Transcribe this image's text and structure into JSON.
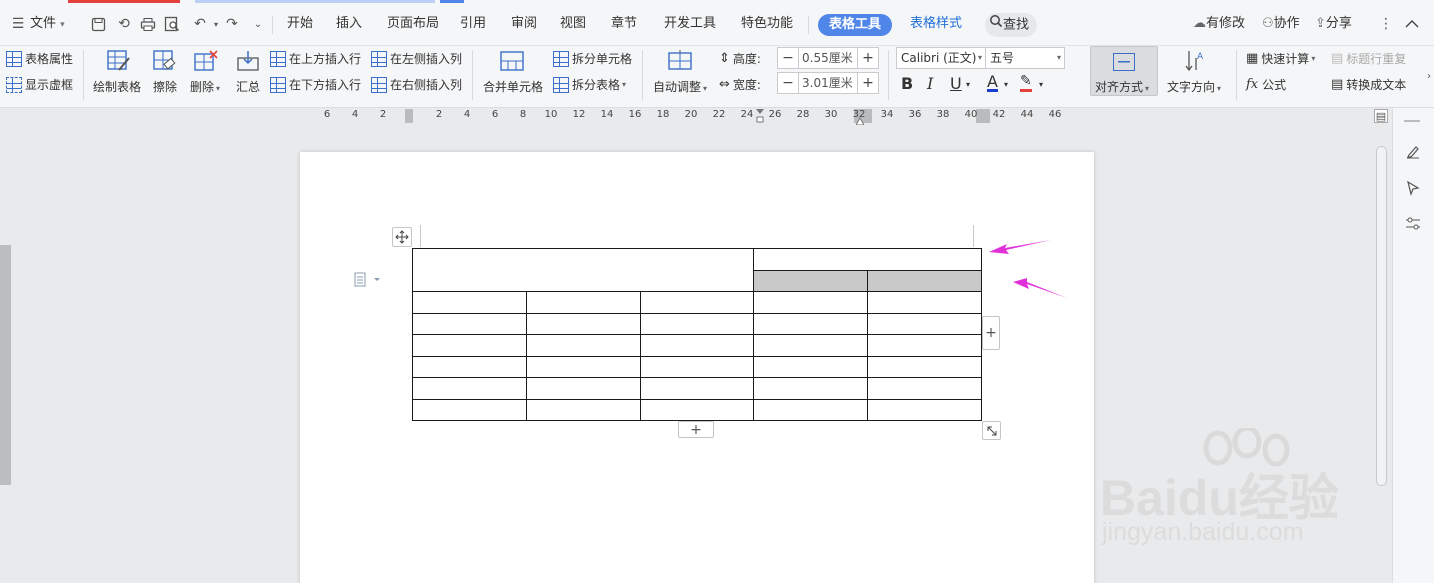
{
  "colors": {
    "accent": "#4f86e8",
    "table_tab_blue": "#1e6fd9",
    "arrow_magenta": "#e030d8",
    "shaded_cell": "#c9c9c9",
    "tabstrip_red": "#e5413a",
    "tabstrip_blue": "#4f86e8"
  },
  "menubar": {
    "file": "文件",
    "tabs": [
      "开始",
      "插入",
      "页面布局",
      "引用",
      "审阅",
      "视图",
      "章节",
      "开发工具",
      "特色功能"
    ],
    "active_tab": "表格工具",
    "secondary_tab": "表格样式",
    "search": "查找",
    "modified": "有修改",
    "collaborate": "协作",
    "share": "分享"
  },
  "ribbon": {
    "table_props": "表格属性",
    "show_gridlines": "显示虚框",
    "draw_table": "绘制表格",
    "erase": "擦除",
    "delete": "删除",
    "summarize": "汇总",
    "insert_row_above": "在上方插入行",
    "insert_row_below": "在下方插入行",
    "insert_col_left": "在左侧插入列",
    "insert_col_right": "在右侧插入列",
    "merge_cells": "合并单元格",
    "split_cells": "拆分单元格",
    "split_table": "拆分表格",
    "auto_fit": "自动调整",
    "height_label": "高度:",
    "height_value": "0.55厘米",
    "width_label": "宽度:",
    "width_value": "3.01厘米",
    "font_name": "Calibri (正文)",
    "font_size": "五号",
    "align": "对齐方式",
    "text_direction": "文字方向",
    "quick_calc": "快速计算",
    "repeat_header": "标题行重复",
    "formula": "公式",
    "convert_text": "转换成文本"
  },
  "ruler": {
    "labels": [
      "6",
      "4",
      "2",
      "2",
      "4",
      "6",
      "8",
      "10",
      "12",
      "14",
      "16",
      "18",
      "20",
      "22",
      "24",
      "26",
      "28",
      "30",
      "32",
      "34",
      "36",
      "38",
      "40",
      "42",
      "44",
      "46"
    ]
  },
  "document": {
    "table": {
      "rows": 8,
      "columns": 5,
      "merged_header": "rows 1-2 × columns 1-3",
      "shaded_cells": "row 2, columns 4-5",
      "cells": []
    }
  },
  "watermark": {
    "brand": "Baidu经验",
    "url": "jingyan.baidu.com"
  }
}
